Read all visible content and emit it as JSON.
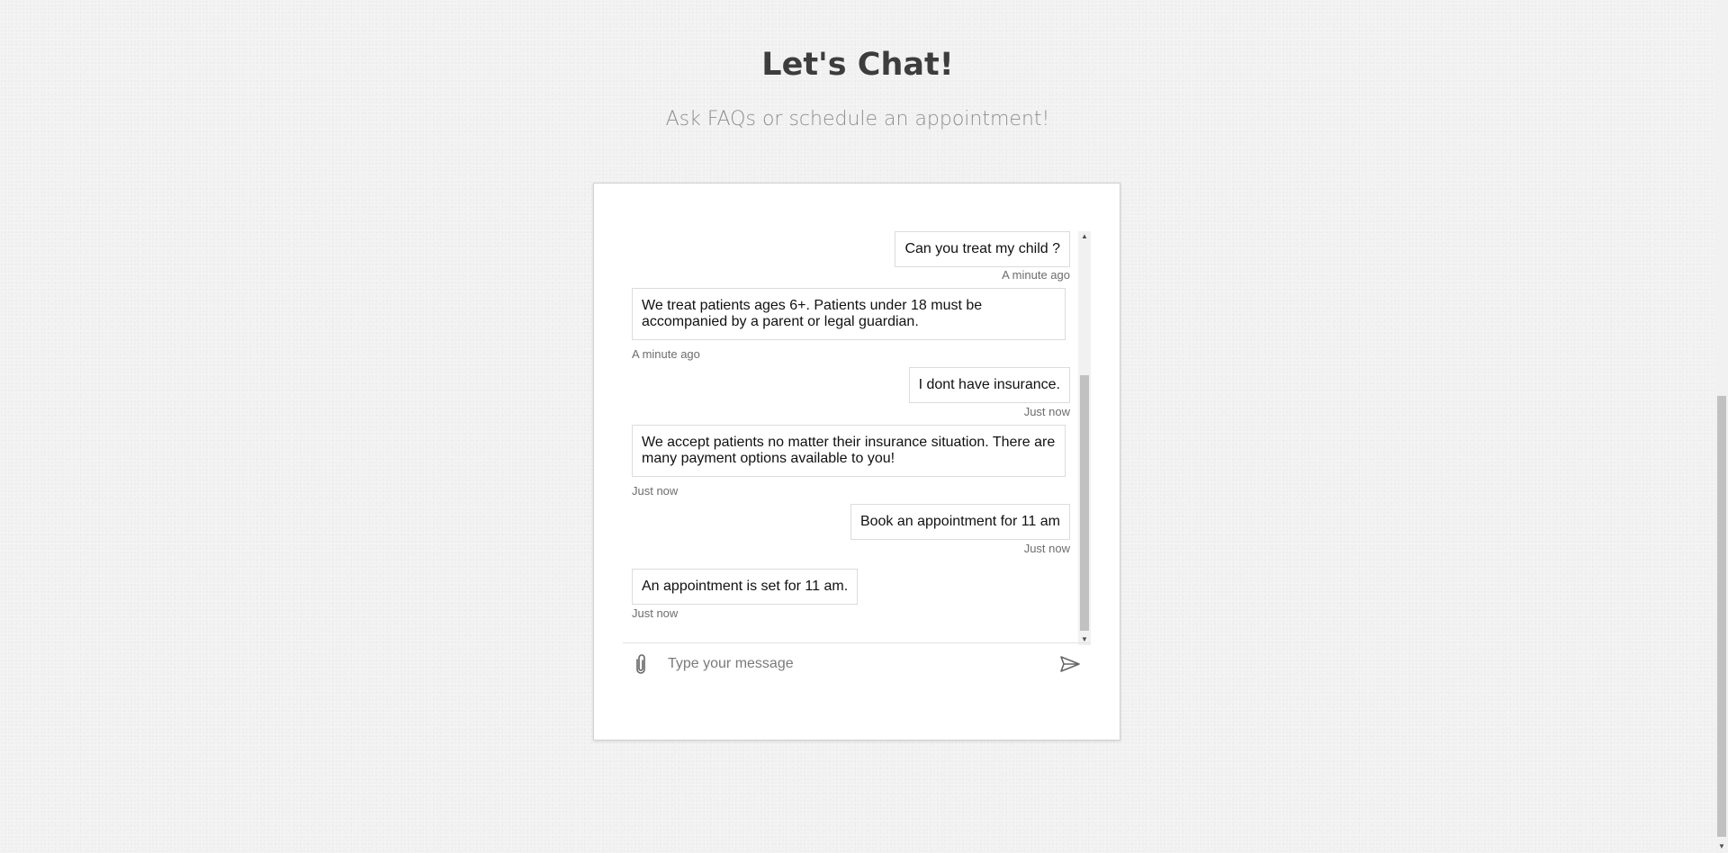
{
  "header": {
    "title": "Let's Chat!",
    "subtitle": "Ask FAQs or schedule an appointment!"
  },
  "chat": {
    "messages": [
      {
        "sender": "user",
        "text": "Can you treat my child ?",
        "time": "A minute ago"
      },
      {
        "sender": "bot",
        "text": "We treat patients ages 6+. Patients under 18 must be accompanied by a parent or legal guardian.",
        "time": "A minute ago"
      },
      {
        "sender": "user",
        "text": "I dont have insurance.",
        "time": "Just now"
      },
      {
        "sender": "bot",
        "text": "We accept patients no matter their insurance situation. There are many payment options available to you!",
        "time": "Just now"
      },
      {
        "sender": "user",
        "text": "Book an appointment for 11 am",
        "time": "Just now"
      },
      {
        "sender": "bot",
        "text": "An appointment is set for 11 am.",
        "time": "Just now"
      }
    ],
    "input": {
      "placeholder": "Type your message",
      "value": ""
    }
  },
  "icons": {
    "attach": "paperclip-icon",
    "send": "send-icon"
  },
  "colors": {
    "title": "#3d3d3d",
    "subtitle": "#8e8e8e",
    "bubble_border": "#dcdcdc",
    "timestamp": "#6d6d6d"
  }
}
